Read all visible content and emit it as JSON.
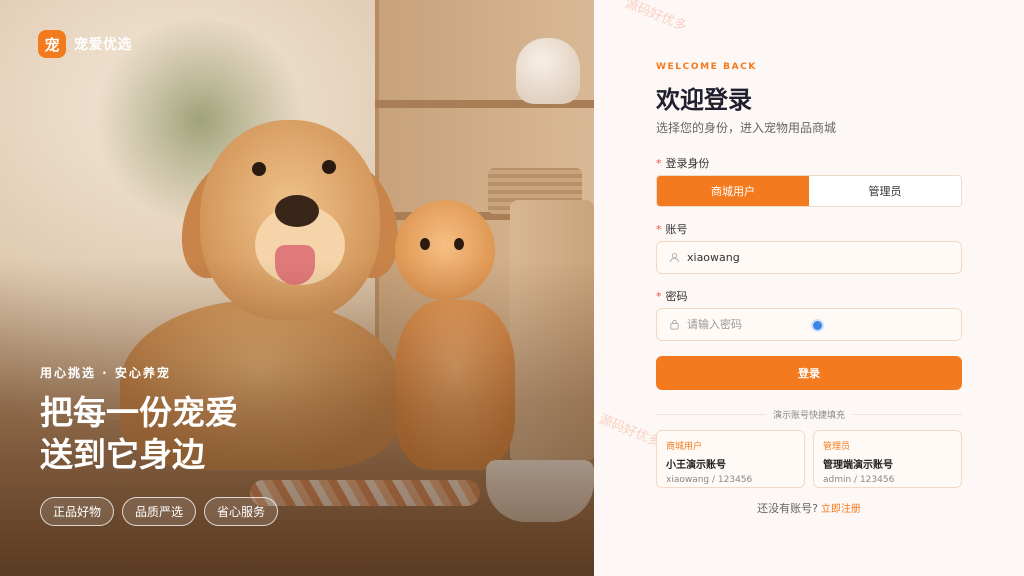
{
  "brand": {
    "logo_char": "宠",
    "name": "宠爱优选"
  },
  "hero": {
    "slogan": "用心挑选 · 安心养宠",
    "title_line1": "把每一份宠爱",
    "title_line2": "送到它身边",
    "chips": [
      "正品好物",
      "品质严选",
      "省心服务"
    ]
  },
  "login": {
    "eyebrow": "WELCOME BACK",
    "title": "欢迎登录",
    "subtitle": "选择您的身份，进入宠物用品商城",
    "role_label": "登录身份",
    "roles": [
      "商城用户",
      "管理员"
    ],
    "active_role": "商城用户",
    "account_label": "账号",
    "account_value": "xiaowang",
    "password_label": "密码",
    "password_placeholder": "请输入密码",
    "submit_label": "登录",
    "quick_fill_label": "演示账号快捷填充",
    "demo_accounts": [
      {
        "role": "商城用户",
        "name": "小王演示账号",
        "credentials": "xiaowang / 123456"
      },
      {
        "role": "管理员",
        "name": "管理端演示账号",
        "credentials": "admin / 123456"
      }
    ],
    "register_prompt": "还没有账号?",
    "register_link": "立即注册"
  },
  "watermark_text": "源码好优多",
  "colors": {
    "accent": "#f47a1f",
    "required": "#f0523a",
    "background": "#fdf8f5"
  }
}
